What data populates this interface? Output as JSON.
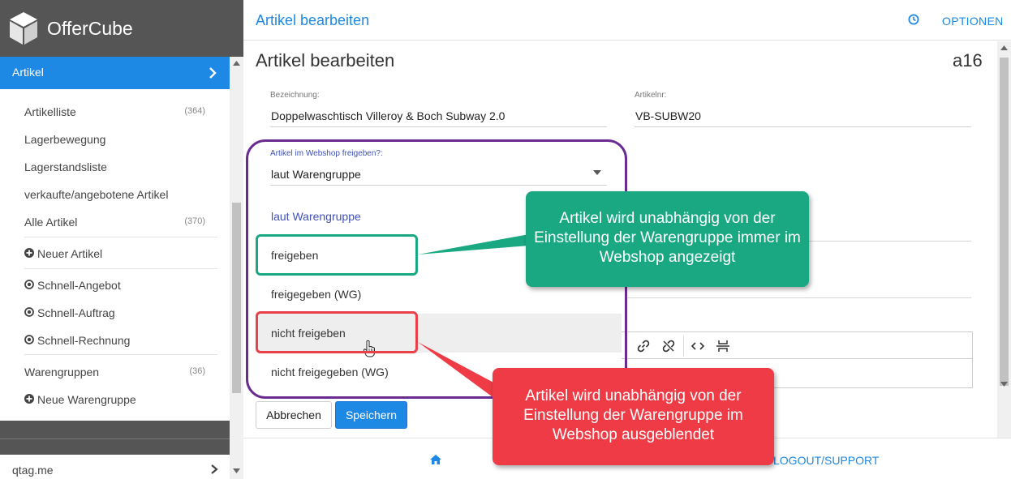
{
  "brand": {
    "name": "OfferCube"
  },
  "sidebar": {
    "section": "Artikel",
    "items": [
      {
        "label": "Artikelliste",
        "count": "(364)"
      },
      {
        "label": "Lagerbewegung",
        "count": ""
      },
      {
        "label": "Lagerstandsliste",
        "count": ""
      },
      {
        "label": "verkaufte/angebotene Artikel",
        "count": ""
      },
      {
        "label": "Alle Artikel",
        "count": "(370)"
      },
      {
        "label": "Neuer Artikel",
        "count": ""
      },
      {
        "label": "Schnell-Angebot",
        "count": ""
      },
      {
        "label": "Schnell-Auftrag",
        "count": ""
      },
      {
        "label": "Schnell-Rechnung",
        "count": ""
      },
      {
        "label": "Warengruppen",
        "count": "(36)"
      },
      {
        "label": "Neue Warengruppe",
        "count": ""
      }
    ],
    "bottom_item": "qtag.me"
  },
  "topbar": {
    "title": "Artikel bearbeiten",
    "options": "OPTIONEN"
  },
  "main": {
    "title": "Artikel bearbeiten",
    "code": "a16",
    "fields": {
      "bezeichnung": {
        "label": "Bezeichnung:",
        "value": "Doppelwaschtisch Villeroy & Boch Subway 2.0"
      },
      "artikelnr": {
        "label": "Artikelnr:",
        "value": "VB-SUBW20"
      },
      "webshop": {
        "label": "Artikel im Webshop freigeben?:",
        "value": "laut Warengruppe"
      }
    },
    "dropdown_options": [
      "laut Warengruppe",
      "freigeben",
      "freigegeben (WG)",
      "nicht freigeben",
      "nicht freigegeben (WG)"
    ],
    "buttons": {
      "cancel": "Abbrechen",
      "save": "Speichern"
    }
  },
  "footer": {
    "logout": "LOGOUT/SUPPORT"
  },
  "annotations": {
    "teal": "Artikel wird unabhängig von der Einstellung der Warengruppe immer im Webshop angezeigt",
    "red": "Artikel wird unabhängig von der Einstellung der Warengruppe im Webshop ausgeblendet"
  },
  "colors": {
    "accent": "#1e88e5",
    "teal": "#19a882",
    "red": "#ee3b45",
    "purple": "#6a2c91",
    "sidebar_dark": "#555555"
  }
}
